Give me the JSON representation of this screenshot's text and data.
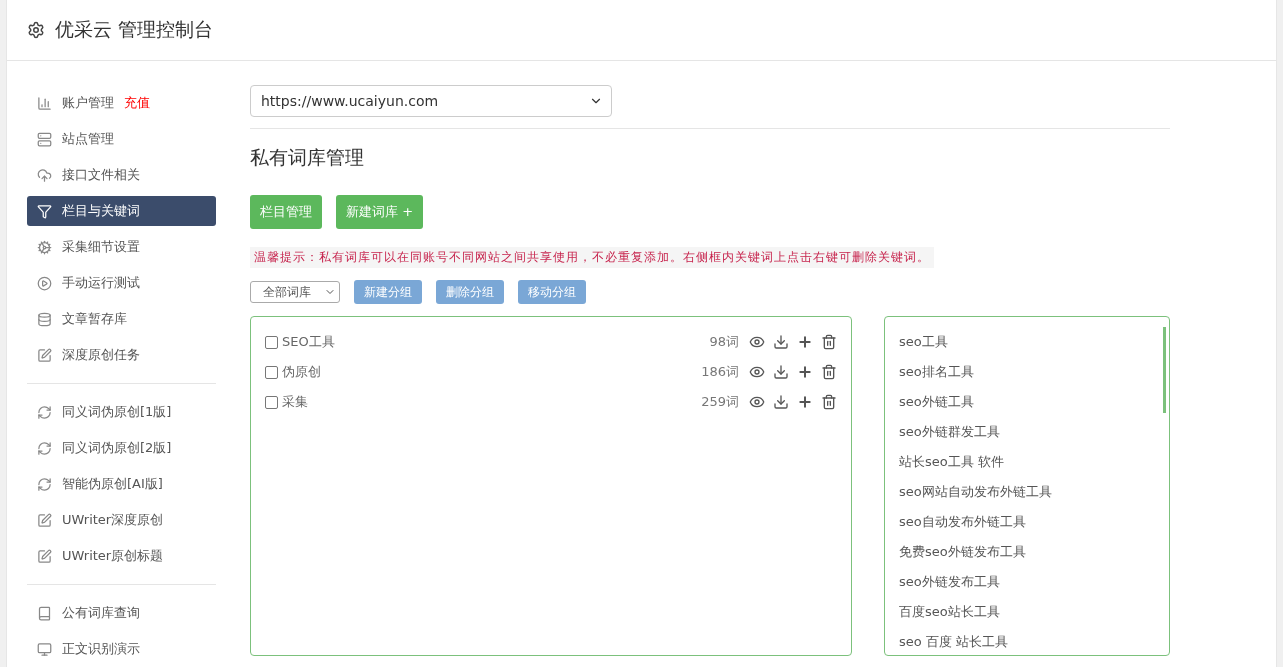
{
  "header": {
    "title": "优采云 管理控制台"
  },
  "sidebar": {
    "groups": [
      [
        {
          "label": "账户管理",
          "badge": "充值",
          "selected": false
        },
        {
          "label": "站点管理",
          "selected": false
        },
        {
          "label": "接口文件相关",
          "selected": false
        },
        {
          "label": "栏目与关键词",
          "selected": true
        },
        {
          "label": "采集细节设置",
          "selected": false
        },
        {
          "label": "手动运行测试",
          "selected": false
        },
        {
          "label": "文章暂存库",
          "selected": false
        },
        {
          "label": "深度原创任务",
          "selected": false
        }
      ],
      [
        {
          "label": "同义词伪原创[1版]",
          "selected": false
        },
        {
          "label": "同义词伪原创[2版]",
          "selected": false
        },
        {
          "label": "智能伪原创[AI版]",
          "selected": false
        },
        {
          "label": "UWriter深度原创",
          "selected": false
        },
        {
          "label": "UWriter原创标题",
          "selected": false
        }
      ],
      [
        {
          "label": "公有词库查询",
          "selected": false
        },
        {
          "label": "正文识别演示",
          "selected": false
        }
      ]
    ]
  },
  "site_select": {
    "value": "https://www.ucaiyun.com"
  },
  "heading": "私有词库管理",
  "action_buttons": [
    "栏目管理",
    "新建词库 +"
  ],
  "hint": "温馨提示：私有词库可以在同账号不同网站之间共享使用，不必重复添加。右侧框内关键词上点击右键可删除关键词。",
  "group_select": {
    "value": "全部词库"
  },
  "group_buttons": [
    "新建分组",
    "删除分组",
    "移动分组"
  ],
  "libraries": [
    {
      "name": "SEO工具",
      "count": "98词",
      "checked": false
    },
    {
      "name": "伪原创",
      "count": "186词",
      "checked": false
    },
    {
      "name": "采集",
      "count": "259词",
      "checked": false
    }
  ],
  "keywords": [
    "seo工具",
    "seo排名工具",
    "seo外链工具",
    "seo外链群发工具",
    "站长seo工具 软件",
    "seo网站自动发布外链工具",
    "seo自动发布外链工具",
    "免费seo外链发布工具",
    "seo外链发布工具",
    "百度seo站长工具",
    "seo 百度 站长工具"
  ]
}
